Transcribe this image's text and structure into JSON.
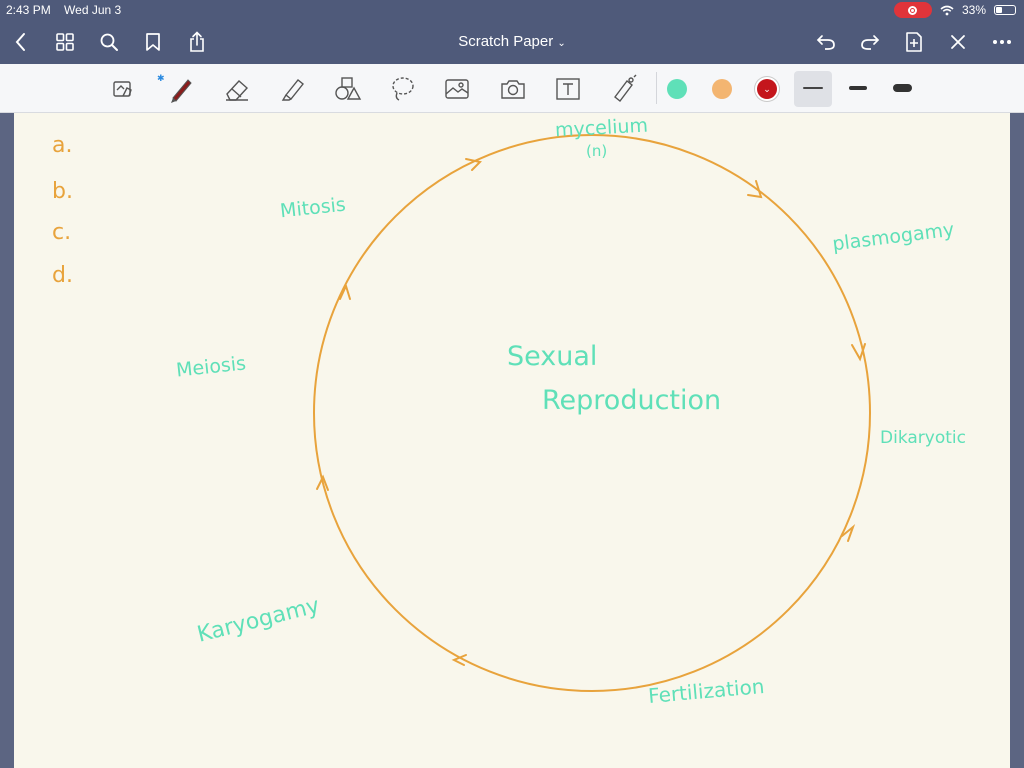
{
  "status": {
    "time": "2:43 PM",
    "date": "Wed Jun 3",
    "battery": "33%"
  },
  "header": {
    "title": "Scratch Paper"
  },
  "icons": {
    "back": "chevron-left-icon",
    "grid": "grid-icon",
    "search": "search-icon",
    "bookmark": "bookmark-icon",
    "share": "share-icon",
    "undo": "undo-icon",
    "redo": "redo-icon",
    "add_page": "add-page-icon",
    "close": "close-icon",
    "more": "more-icon"
  },
  "toolbar": {
    "tools": [
      "reading-mode-icon",
      "pen-icon",
      "eraser-icon",
      "highlighter-icon",
      "shapes-icon",
      "lasso-icon",
      "image-icon",
      "camera-icon",
      "text-icon",
      "laser-pointer-icon"
    ],
    "colors": [
      "#5fe0b8",
      "#f3b571",
      "#c4161c"
    ],
    "selected_color": "#c4161c",
    "selected_thickness": "thin"
  },
  "canvas": {
    "list_letters": [
      "a.",
      "b.",
      "c.",
      "d."
    ],
    "center_line1": "Sexual",
    "center_line2": "Reproduction",
    "labels": {
      "mycelium": "mycelium",
      "mycelium_ploidy": "(n)",
      "plasmogamy": "plasmogamy",
      "dikaryotic": "Dikaryotic",
      "fertilization": "Fertilization",
      "karyogamy": "Karyogamy",
      "meiosis": "Meiosis",
      "mitosis": "Mitosis"
    },
    "circle_color": "#e8a33c",
    "ink_color": "#5fe0b8"
  }
}
